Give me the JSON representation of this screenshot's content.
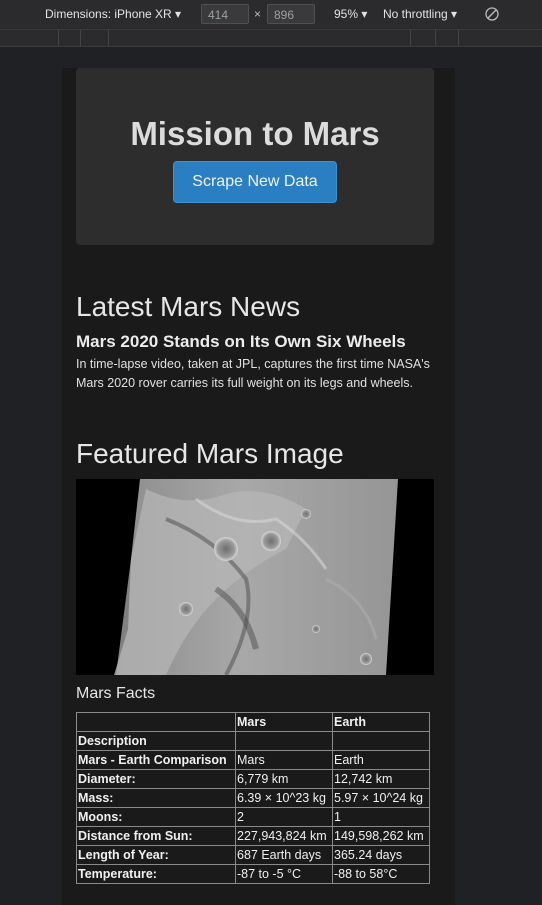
{
  "devtools": {
    "dimensions_label": "Dimensions: iPhone XR ▾",
    "width_value": "414",
    "times": "×",
    "height_value": "896",
    "zoom_label": "95% ▾",
    "throttle_label": "No throttling ▾",
    "rotate_icon": "rotate-icon"
  },
  "page": {
    "title": "Mission to Mars",
    "scrape_button": "Scrape New Data",
    "news_heading": "Latest Mars News",
    "news_title": "Mars 2020 Stands on Its Own Six Wheels",
    "news_paragraph": "In time-lapse video, taken at JPL, captures the first time NASA's Mars 2020 rover carries its full weight on its legs and wheels.",
    "image_heading": "Featured Mars Image",
    "facts_heading": "Mars Facts"
  },
  "facts_table": {
    "headers": [
      "",
      "Mars",
      "Earth"
    ],
    "rows": [
      [
        "Description",
        "",
        ""
      ],
      [
        "Mars - Earth Comparison",
        "Mars",
        "Earth"
      ],
      [
        "Diameter:",
        "6,779 km",
        "12,742 km"
      ],
      [
        "Mass:",
        "6.39 × 10^23 kg",
        "5.97 × 10^24 kg"
      ],
      [
        "Moons:",
        "2",
        "1"
      ],
      [
        "Distance from Sun:",
        "227,943,824 km",
        "149,598,262 km"
      ],
      [
        "Length of Year:",
        "687 Earth days",
        "365.24 days"
      ],
      [
        "Temperature:",
        "-87 to -5 °C",
        "-88 to 58°C"
      ]
    ]
  },
  "colors": {
    "button": "#2a7fc2",
    "jumbotron": "#2d2d2d",
    "page_bg": "#1a1a1a"
  }
}
